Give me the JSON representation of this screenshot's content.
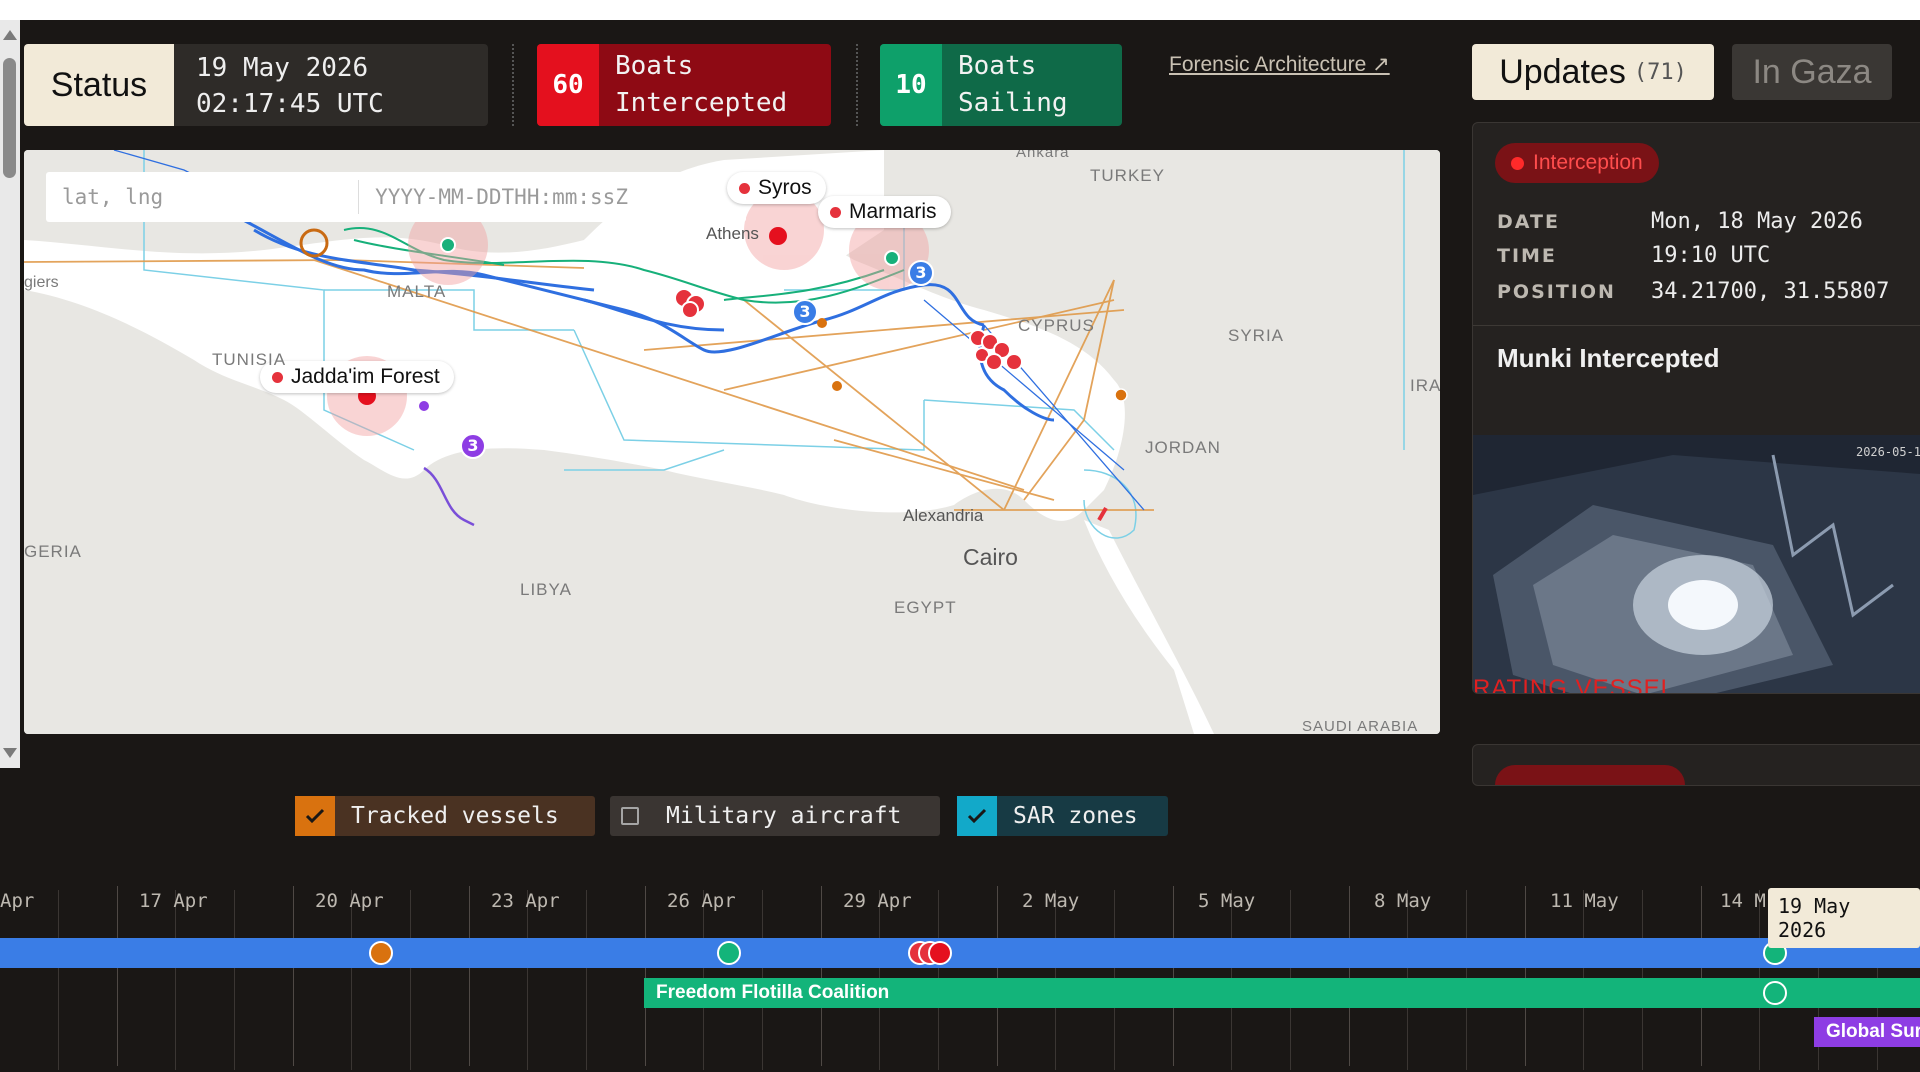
{
  "status": {
    "label": "Status",
    "date": "19 May 2026",
    "time": "02:17:45 UTC"
  },
  "counters": {
    "intercepted": {
      "value": "60",
      "label_line1": "Boats",
      "label_line2": "Intercepted",
      "color": "#e4101e"
    },
    "sailing": {
      "value": "10",
      "label_line1": "Boats",
      "label_line2": "Sailing",
      "color": "#0ea06a"
    }
  },
  "forensic_link": "Forensic Architecture ↗",
  "map": {
    "coord_placeholder": "lat, lng",
    "datetime_placeholder": "YYYY-MM-DDTHH:mm:ssZ",
    "pins": [
      "Syros",
      "Marmaris",
      "Jadda'im Forest"
    ],
    "countries": [
      "TURKEY",
      "SYRIA",
      "CYPRUS",
      "TUNISIA",
      "MALTA",
      "LIBYA",
      "EGYPT",
      "JORDAN",
      "GERIA",
      "IRA",
      "SAUDI ARABIA",
      "Ankara",
      "giers"
    ],
    "cities": [
      "Athens",
      "Alexandria",
      "Cairo"
    ],
    "cluster_counts": [
      "3",
      "3",
      "3"
    ]
  },
  "updates": {
    "tab_label": "Updates",
    "count": "(71)",
    "gaza_tab": "In Gaza",
    "card": {
      "badge": "Interception",
      "date_label": "DATE",
      "date_value": "Mon, 18 May 2026",
      "time_label": "TIME",
      "time_value": "19:10 UTC",
      "position_label": "POSITION",
      "position_value": "34.21700, 31.55807",
      "title": "Munki Intercepted",
      "photo_stamp": "2026-05-1",
      "photo_overlay": "RATING VESSEL"
    }
  },
  "layers": {
    "tracked_vessels": {
      "label": "Tracked vessels",
      "checked": true
    },
    "military_aircraft": {
      "label": "Military aircraft",
      "checked": false
    },
    "sar_zones": {
      "label": "SAR zones",
      "checked": true
    }
  },
  "timeline": {
    "labels": [
      "Apr",
      "17 Apr",
      "20 Apr",
      "23 Apr",
      "26 Apr",
      "29 Apr",
      "2 May",
      "5 May",
      "8 May",
      "11 May",
      "14 M"
    ],
    "current": "19 May 2026",
    "bars": {
      "green": "Freedom Flotilla Coalition",
      "purple": "Global Sur"
    }
  },
  "colors": {
    "background": "#1a1715",
    "accent": "#f2ead8",
    "intercept_red": "#e4101e",
    "sailing_green": "#0ea06a",
    "track_blue": "#3a7de6",
    "track_orange": "#d9720f"
  }
}
